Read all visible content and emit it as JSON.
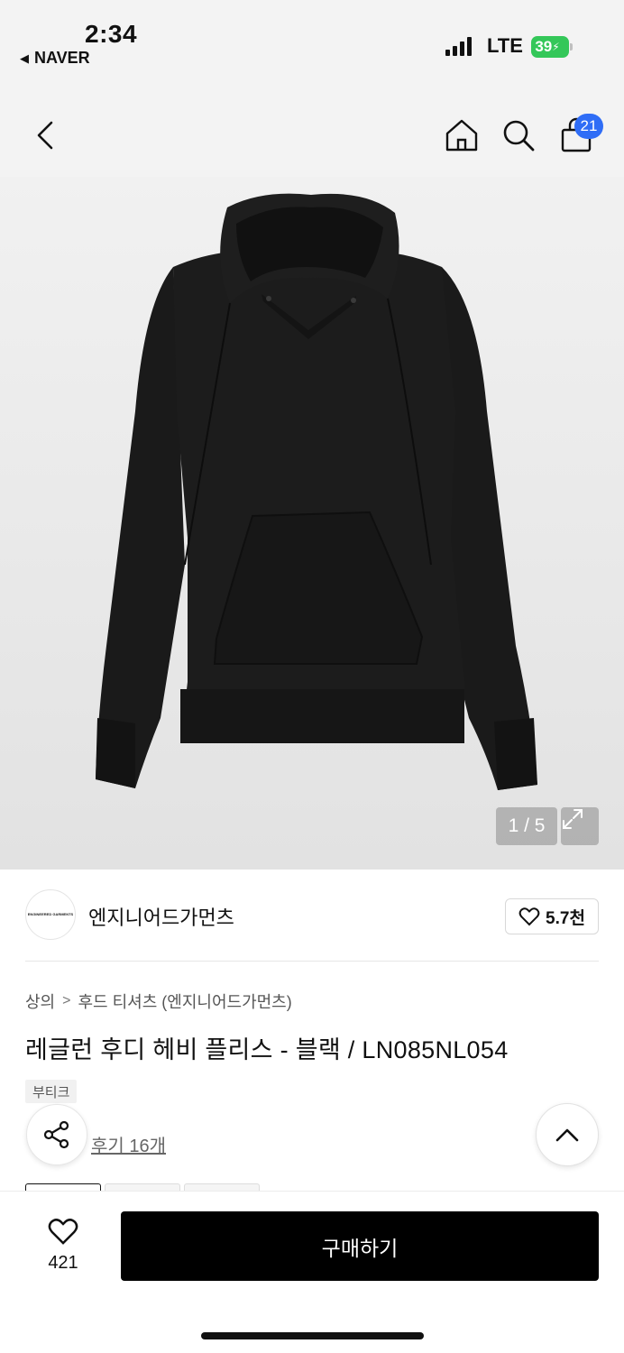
{
  "status_bar": {
    "time": "2:34",
    "back_app": "NAVER",
    "network": "LTE",
    "battery": "39"
  },
  "nav": {
    "cart_count": "21"
  },
  "gallery": {
    "pager": "1 / 5"
  },
  "brand": {
    "name": "엔지니어드가먼츠",
    "logo_text": "ENGINEERED GARMENTS",
    "likes": "5.7천"
  },
  "breadcrumb": {
    "category": "상의",
    "separator": ">",
    "subcategory": "후드 티셔츠 (엔지니어드가먼츠)"
  },
  "product": {
    "title": "레글런 후디 헤비 플리스 - 블랙 / LN085NL054",
    "tag": "부티크",
    "reviews": "후기 16개"
  },
  "bottom_bar": {
    "wish_count": "421",
    "buy_label": "구매하기"
  },
  "colors": {
    "accent": "#2f6df6",
    "battery": "#34c759",
    "buy_button": "#000000"
  }
}
